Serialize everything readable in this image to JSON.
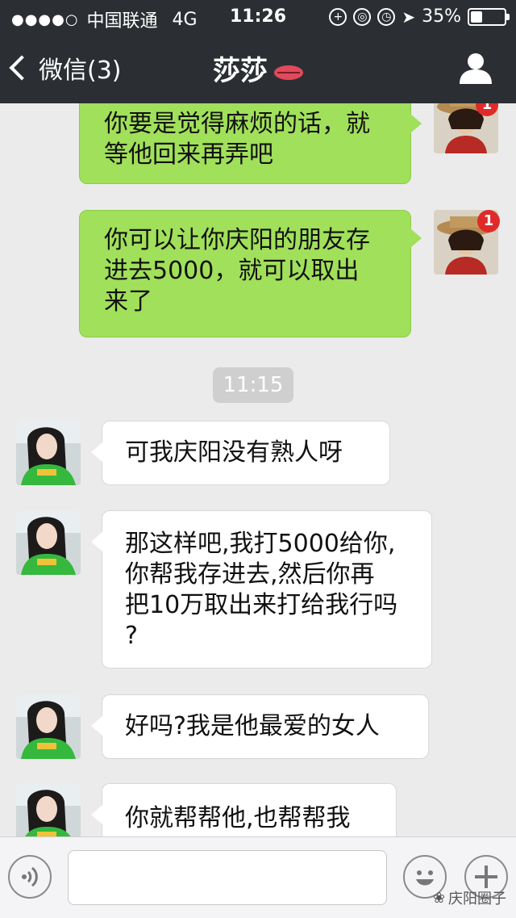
{
  "status_bar": {
    "signal_dots": "●●●●○",
    "carrier": "中国联通",
    "network": "4G",
    "time": "11:26",
    "battery": "35%",
    "battery_level": 0.35
  },
  "nav": {
    "back_label": "微信(3)",
    "title": "莎莎"
  },
  "messages": [
    {
      "side": "out",
      "text_lines": [
        "你要是觉得麻烦的话，就",
        "等他回来再弄吧"
      ]
    },
    {
      "side": "out",
      "text_lines": [
        "你可以让你庆阳的朋友存",
        "进去5000，就可以取出",
        "来了"
      ],
      "badge": "1"
    },
    {
      "type": "timestamp",
      "text": "11:15"
    },
    {
      "side": "in",
      "text_lines": [
        "可我庆阳没有熟人呀"
      ]
    },
    {
      "side": "in",
      "text_lines": [
        "那这样吧,我打5000给你,",
        "你帮我存进去,然后你再",
        "把10万取出来打给我行吗",
        "?"
      ]
    },
    {
      "side": "in",
      "text_lines": [
        "好吗?我是他最爱的女人"
      ]
    },
    {
      "side": "in",
      "text_lines": [
        "你就帮帮他,也帮帮我"
      ]
    }
  ],
  "top_badge": "1",
  "input": {
    "value": ""
  },
  "watermark": "庆阳圈子",
  "colors": {
    "navbar": "#2b2f33",
    "outgoing_bubble": "#a1e05a",
    "incoming_bubble": "#ffffff",
    "badge": "#e02a2a",
    "background": "#ebebeb"
  }
}
